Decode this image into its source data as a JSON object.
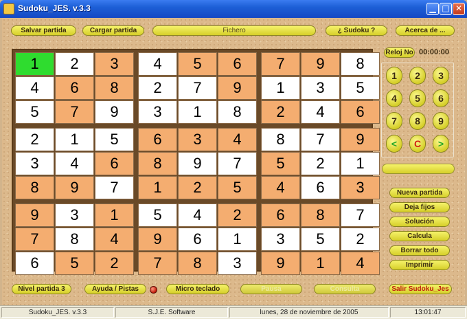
{
  "window": {
    "title": "Sudoku_JES. v.3.3"
  },
  "toolbar": {
    "salvar": "Salvar partida",
    "cargar": "Cargar partida",
    "fichero": "Fichero",
    "sudoku": "¿ Sudoku ?",
    "acerca": "Acerca de ..."
  },
  "board": {
    "grid": [
      [
        1,
        2,
        3,
        4,
        5,
        6,
        7,
        9,
        8
      ],
      [
        4,
        6,
        8,
        2,
        7,
        9,
        1,
        3,
        5
      ],
      [
        5,
        7,
        9,
        3,
        1,
        8,
        2,
        4,
        6
      ],
      [
        2,
        1,
        5,
        6,
        3,
        4,
        8,
        7,
        9
      ],
      [
        3,
        4,
        6,
        8,
        9,
        7,
        5,
        2,
        1
      ],
      [
        8,
        9,
        7,
        1,
        2,
        5,
        4,
        6,
        3
      ],
      [
        9,
        3,
        1,
        5,
        4,
        2,
        6,
        8,
        7
      ],
      [
        7,
        8,
        4,
        9,
        6,
        1,
        3,
        5,
        2
      ],
      [
        6,
        5,
        2,
        7,
        8,
        3,
        9,
        1,
        4
      ]
    ],
    "fills": [
      [
        "G",
        "W",
        "O",
        "W",
        "O",
        "O",
        "O",
        "O",
        "W"
      ],
      [
        "W",
        "O",
        "O",
        "W",
        "W",
        "O",
        "W",
        "W",
        "W"
      ],
      [
        "W",
        "O",
        "W",
        "W",
        "W",
        "W",
        "O",
        "W",
        "O"
      ],
      [
        "W",
        "W",
        "W",
        "O",
        "O",
        "O",
        "W",
        "W",
        "O"
      ],
      [
        "W",
        "W",
        "O",
        "O",
        "W",
        "W",
        "O",
        "W",
        "W"
      ],
      [
        "O",
        "O",
        "W",
        "O",
        "O",
        "O",
        "O",
        "W",
        "O"
      ],
      [
        "O",
        "W",
        "O",
        "W",
        "W",
        "O",
        "O",
        "O",
        "W"
      ],
      [
        "O",
        "W",
        "O",
        "O",
        "W",
        "W",
        "W",
        "W",
        "W"
      ],
      [
        "W",
        "O",
        "O",
        "O",
        "O",
        "W",
        "O",
        "O",
        "O"
      ]
    ],
    "fill_colors": {
      "W": "#ffffff",
      "O": "#f4ad70",
      "G": "#2fdc2f"
    }
  },
  "clock": {
    "label": "Reloj No",
    "time": "00:00:00"
  },
  "numpad": {
    "keys": [
      "1",
      "2",
      "3",
      "4",
      "5",
      "6",
      "7",
      "8",
      "9"
    ],
    "prev": "<",
    "clear": "C",
    "next": ">"
  },
  "actions": {
    "nueva": "Nueva partida",
    "deja_fijos": "Deja fijos",
    "solucion": "Solución",
    "calcula": "Calcula",
    "borrar": "Borrar todo",
    "imprimir": "Imprimir"
  },
  "bottom": {
    "nivel": "Nivel partida 3",
    "ayuda": "Ayuda / Pistas",
    "micro": "Micro teclado",
    "pausa": "Pausa",
    "consulta": "Consulta",
    "salir": "Salir Sudoku_Jes"
  },
  "status": {
    "app": "Sudoku_JES. v.3.3",
    "company": "S.J.E. Software",
    "date": "lunes, 28 de noviembre de 2005",
    "time": "13:01:47"
  },
  "colors": {
    "accent_yellow": "#d6cf2a",
    "title_blue": "#1d5fd6",
    "led_red": "#c01808"
  }
}
